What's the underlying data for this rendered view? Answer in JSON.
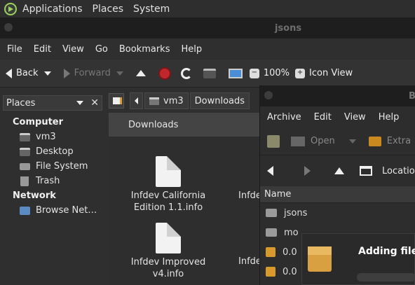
{
  "panel": {
    "menus": [
      "Applications",
      "Places",
      "System"
    ]
  },
  "file_manager": {
    "title": "jsons",
    "menu": [
      "File",
      "Edit",
      "View",
      "Go",
      "Bookmarks",
      "Help"
    ],
    "toolbar": {
      "back_label": "Back",
      "forward_label": "Forward",
      "zoom_level": "100%",
      "view_mode": "Icon View"
    },
    "sidebar": {
      "selector_label": "Places",
      "sections": [
        {
          "heading": "Computer",
          "items": [
            "vm3",
            "Desktop",
            "File System",
            "Trash"
          ]
        },
        {
          "heading": "Network",
          "items": [
            "Browse Net…"
          ]
        }
      ]
    },
    "location": {
      "crumbs": [
        "vm3",
        "Downloads"
      ]
    },
    "content": {
      "header": "Downloads",
      "files": [
        {
          "name": "Infdev California Edition 1.1.info"
        },
        {
          "name": "Infdev Improved v4.info"
        },
        {
          "name": "Infde"
        },
        {
          "name": "Infde"
        }
      ]
    }
  },
  "archive_manager": {
    "title": "B",
    "menu": [
      "Archive",
      "Edit",
      "View",
      "Help"
    ],
    "tools": {
      "open_label": "Open",
      "extract_label": "Extra"
    },
    "nav": {
      "location_label": "Locatio"
    },
    "column_name": "Name",
    "rows": [
      {
        "name": "jsons",
        "type": "folder"
      },
      {
        "name": "mo",
        "type": "folder"
      },
      {
        "name": "0.0",
        "type": "package"
      },
      {
        "name": "0.0",
        "type": "package"
      }
    ]
  },
  "dialog": {
    "message": "Adding files"
  }
}
